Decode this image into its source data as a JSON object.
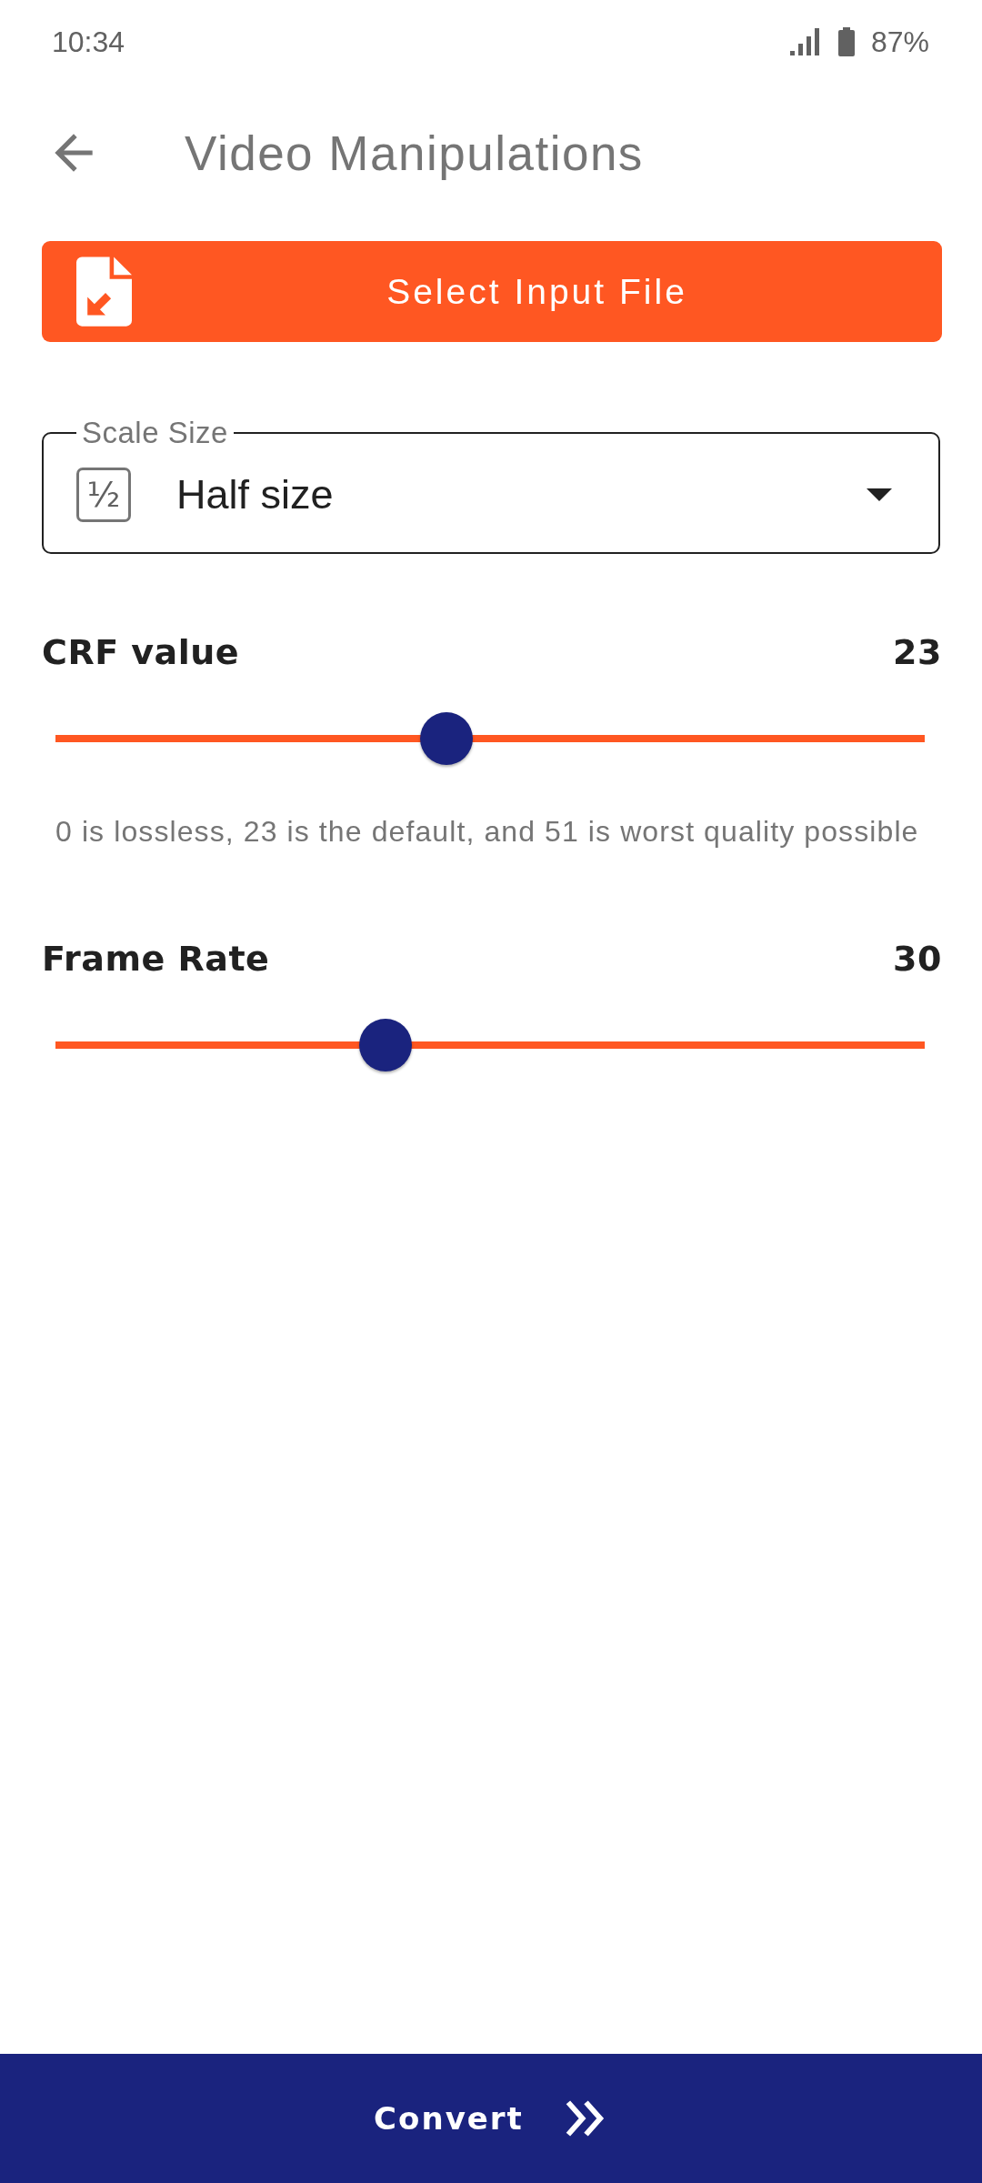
{
  "status_bar": {
    "time": "10:34",
    "battery": "87%"
  },
  "app_bar": {
    "title": "Video Manipulations"
  },
  "select_file_button": {
    "label": "Select Input File"
  },
  "scale_size": {
    "label": "Scale Size",
    "icon_glyph": "½",
    "value": "Half size"
  },
  "sliders": [
    {
      "label": "CRF value",
      "reading": "23",
      "level": 0.45,
      "hint": "0 is lossless, 23 is the default, and 51 is worst quality possible"
    },
    {
      "label": "Frame Rate",
      "reading": "30",
      "level": 0.38
    }
  ],
  "convert_button": {
    "label": "Convert"
  }
}
